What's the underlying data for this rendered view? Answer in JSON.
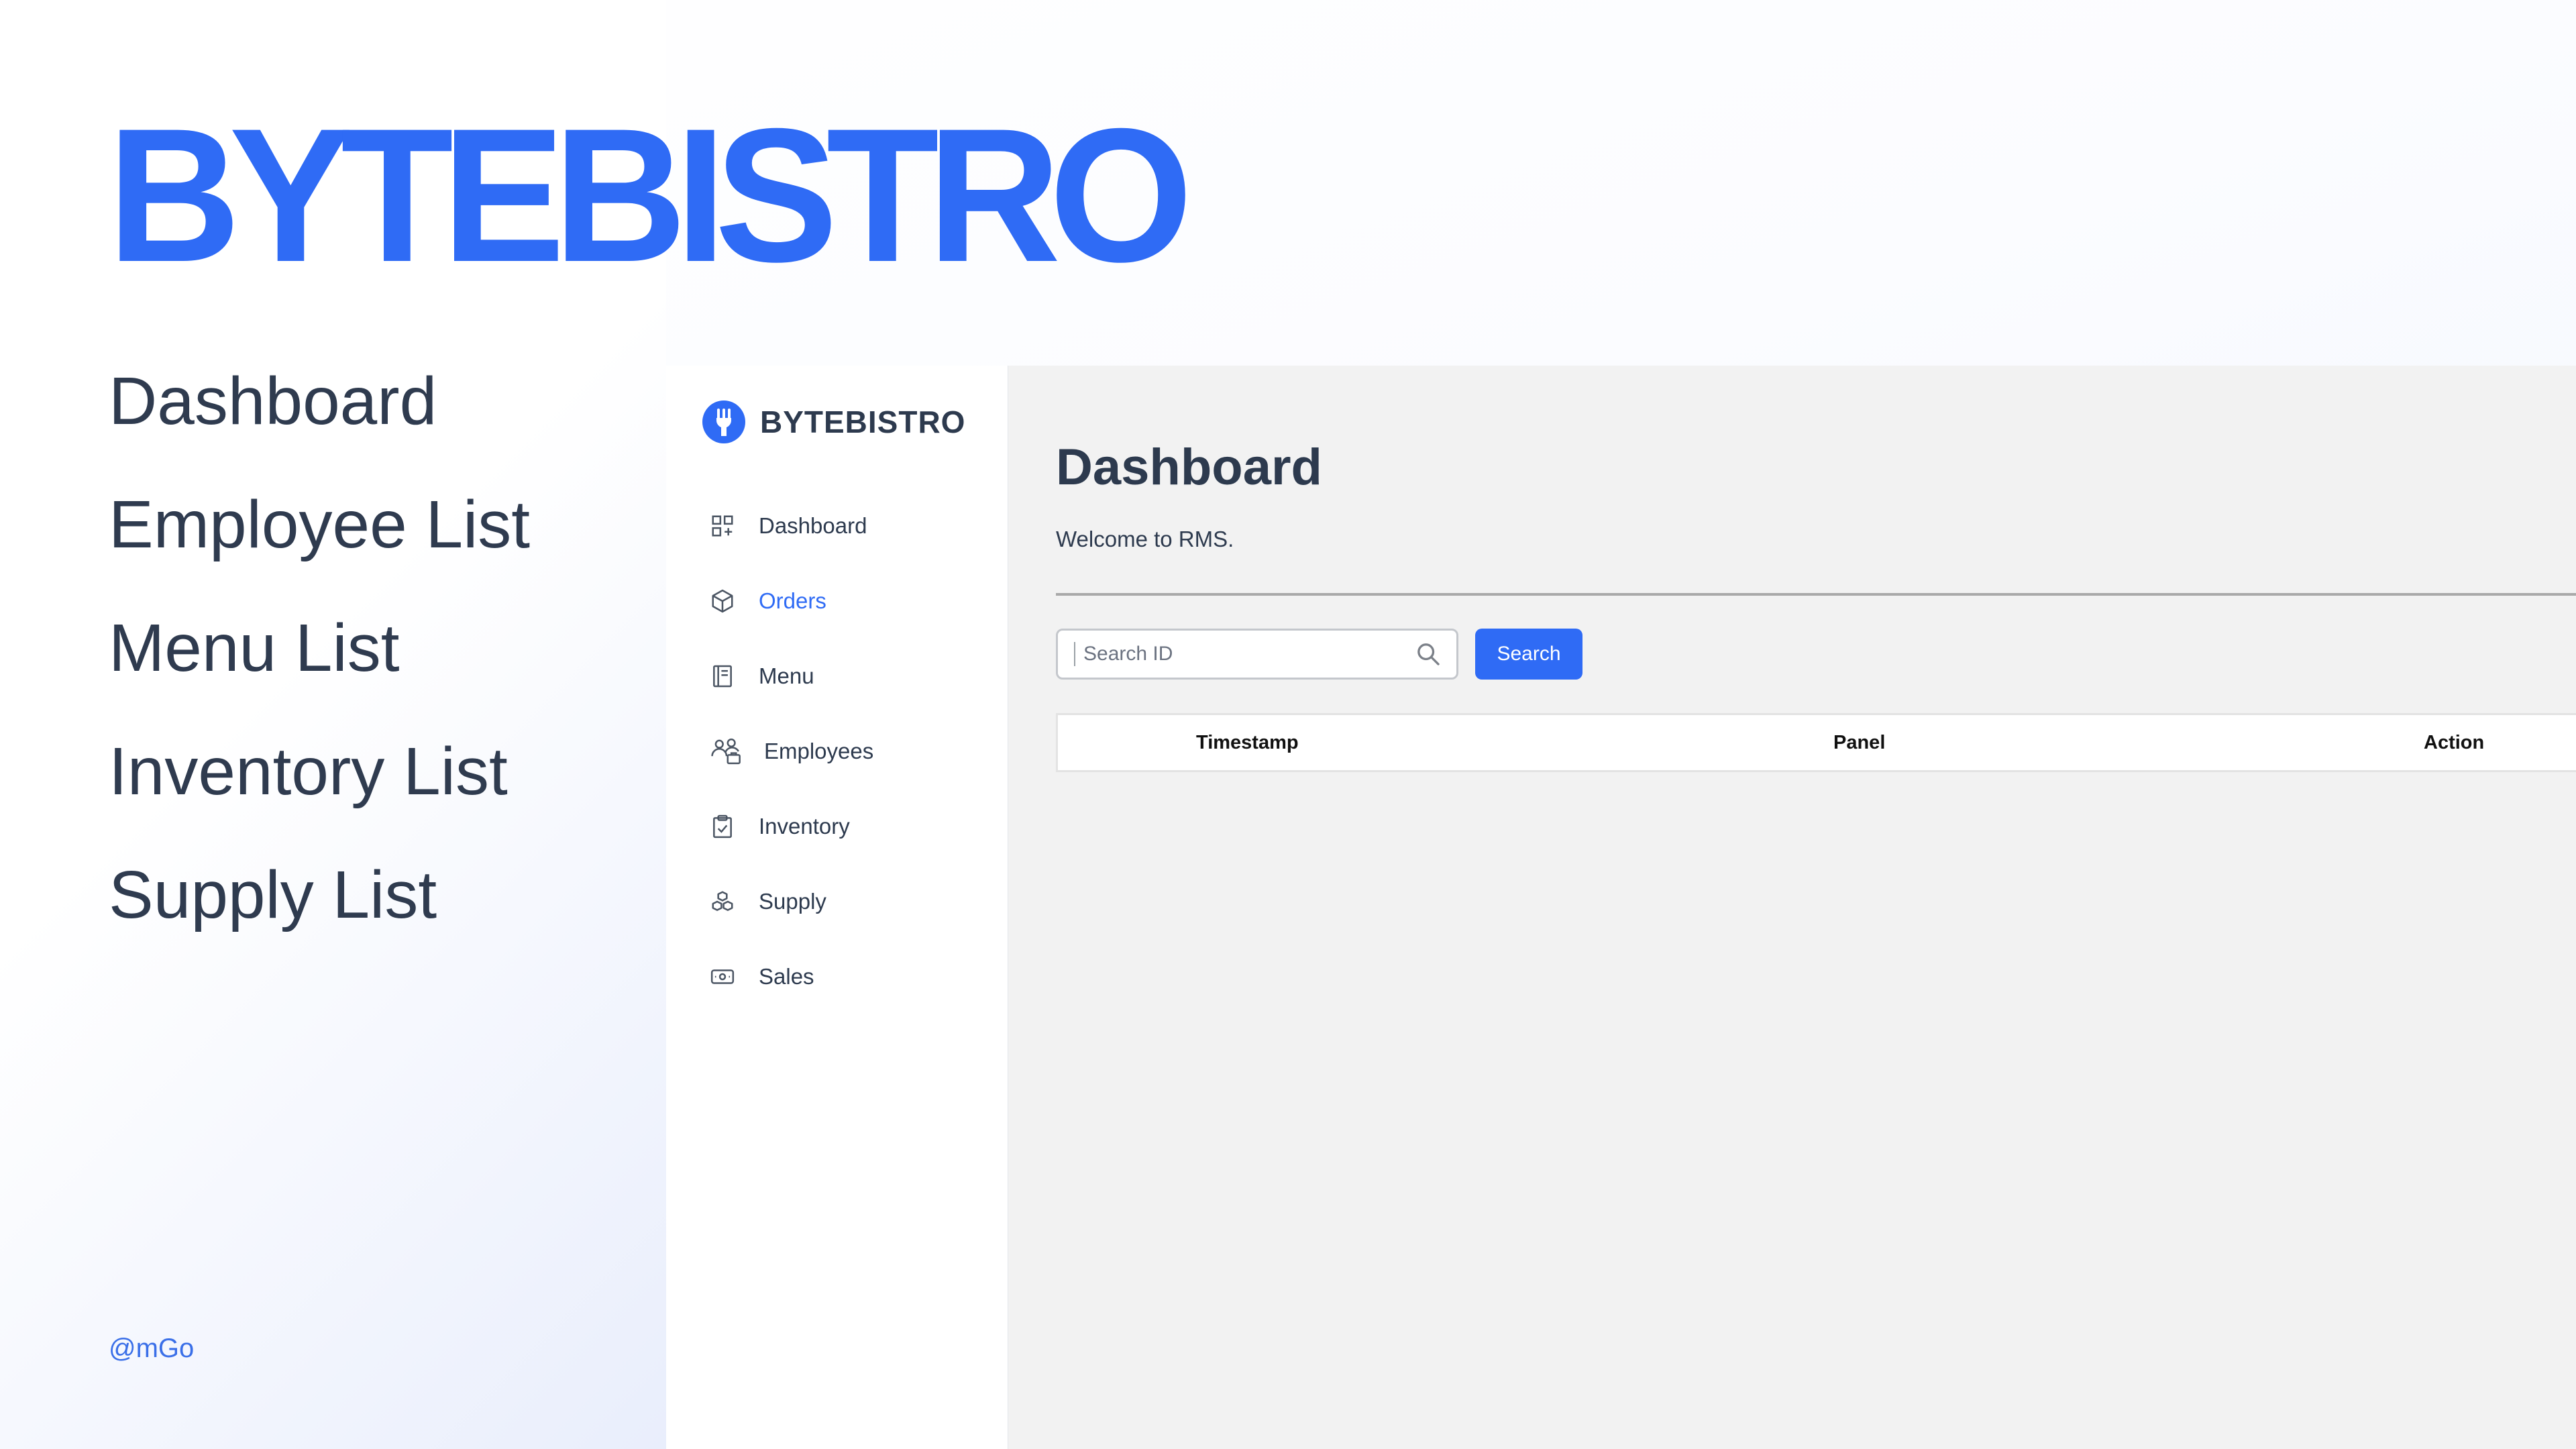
{
  "hero": {
    "brand_title": "BYTEBISTRO",
    "features": [
      "Dashboard",
      "Employee List",
      "Menu List",
      "Inventory List",
      "Supply List"
    ],
    "handle": "@mGo"
  },
  "app": {
    "logo_text": "BYTEBISTRO",
    "nav": [
      {
        "label": "Dashboard",
        "icon": "dashboard-grid-icon",
        "active": false
      },
      {
        "label": "Orders",
        "icon": "box-icon",
        "active": true
      },
      {
        "label": "Menu",
        "icon": "book-icon",
        "active": false
      },
      {
        "label": "Employees",
        "icon": "people-icon",
        "active": false
      },
      {
        "label": "Inventory",
        "icon": "clipboard-check-icon",
        "active": false
      },
      {
        "label": "Supply",
        "icon": "boxes-icon",
        "active": false
      },
      {
        "label": "Sales",
        "icon": "cash-icon",
        "active": false
      }
    ],
    "main": {
      "title": "Dashboard",
      "subtitle": "Welcome to RMS.",
      "search": {
        "placeholder": "Search ID",
        "value": "",
        "button_label": "Search"
      },
      "table": {
        "columns": [
          "Timestamp",
          "Panel",
          "Action"
        ],
        "rows": []
      }
    }
  },
  "colors": {
    "accent": "#2f6bf5",
    "text": "#2d3a4e",
    "main_bg": "#f2f2f2"
  }
}
